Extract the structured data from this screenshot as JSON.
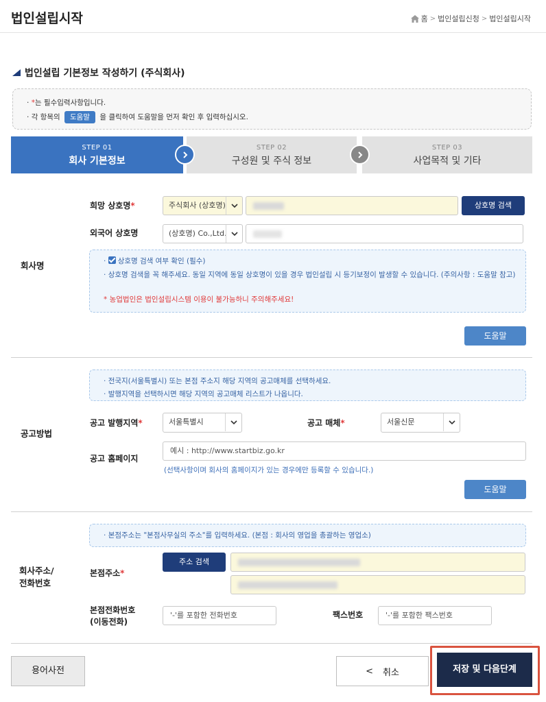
{
  "header": {
    "title": "법인설립시작",
    "breadcrumb": [
      "홈",
      "법인설립신청",
      "법인설립시작"
    ]
  },
  "section_heading": "법인설립 기본정보 작성하기 (주식회사)",
  "notice": {
    "line1_mark": "*",
    "line1_text": "는 필수입력사항입니다.",
    "line2_before": "각 항목의",
    "line2_chip": "도움말",
    "line2_after": "을 클릭하여 도움말을 먼저 확인 후 입력하십시오."
  },
  "steps": [
    {
      "num": "STEP 01",
      "title": "회사 기본정보",
      "active": true
    },
    {
      "num": "STEP 02",
      "title": "구성원 및 주식 정보",
      "active": false
    },
    {
      "num": "STEP 03",
      "title": "사업목적 및 기타",
      "active": false
    }
  ],
  "company_name": {
    "section_label": "회사명",
    "desired_label": "희망 상호명",
    "desired_type": "주식회사 (상호명)",
    "search_button": "상호명 검색",
    "foreign_label": "외국어 상호명",
    "foreign_type": "(상호명) Co.,Ltd.",
    "info_check": "상호명 검색 여부 확인 (필수)",
    "info_line2": "상호명 검색을 꼭 해주세요. 동일 지역에 동일 상호명이 있을 경우 법인설립 시 등기보정이 발생할 수 있습니다. (주의사항 : 도움말 참고)",
    "info_warning": "농업법인은 법인설립시스템 이용이 불가능하니 주의해주세요!",
    "help_button": "도움말"
  },
  "announcement": {
    "section_label": "공고방법",
    "info_line1": "전국지(서울특별시) 또는 본점 주소지 해당 지역의 공고매체를 선택하세요.",
    "info_line2": "발행지역을 선택하시면 해당 지역의 공고매체 리스트가 나옵니다.",
    "region_label": "공고 발행지역",
    "region_value": "서울특별시",
    "media_label": "공고 매체",
    "media_value": "서울신문",
    "homepage_label": "공고 홈페이지",
    "homepage_placeholder": "예시 : http://www.startbiz.go.kr",
    "homepage_hint": "(선택사항이며 회사의 홈페이지가 있는 경우에만 등록할 수 있습니다.)",
    "help_button": "도움말"
  },
  "address": {
    "section_label_1": "회사주소/",
    "section_label_2": "전화번호",
    "info_line": "본점주소는 \"본점사무실의 주소\"를 입력하세요. (본점 : 회사의 영업을 총괄하는 영업소)",
    "main_label": "본점주소",
    "search_button": "주소 검색",
    "phone_label_1": "본점전화번호",
    "phone_label_2": "(이동전화)",
    "phone_placeholder": "'-'를 포함한 전화번호",
    "fax_label": "팩스번호",
    "fax_placeholder": "'-'를 포함한 팩스번호"
  },
  "footer": {
    "dictionary_button": "용어사전",
    "cancel_arrow": "<",
    "cancel_button": "취소",
    "next_button": "저장 및 다음단계"
  },
  "colors": {
    "step_active": "#3a73c0",
    "navy_button": "#1f3d7a",
    "next_button": "#1c2b4a",
    "required": "#e03a3a",
    "highlight": "#d9533f"
  }
}
